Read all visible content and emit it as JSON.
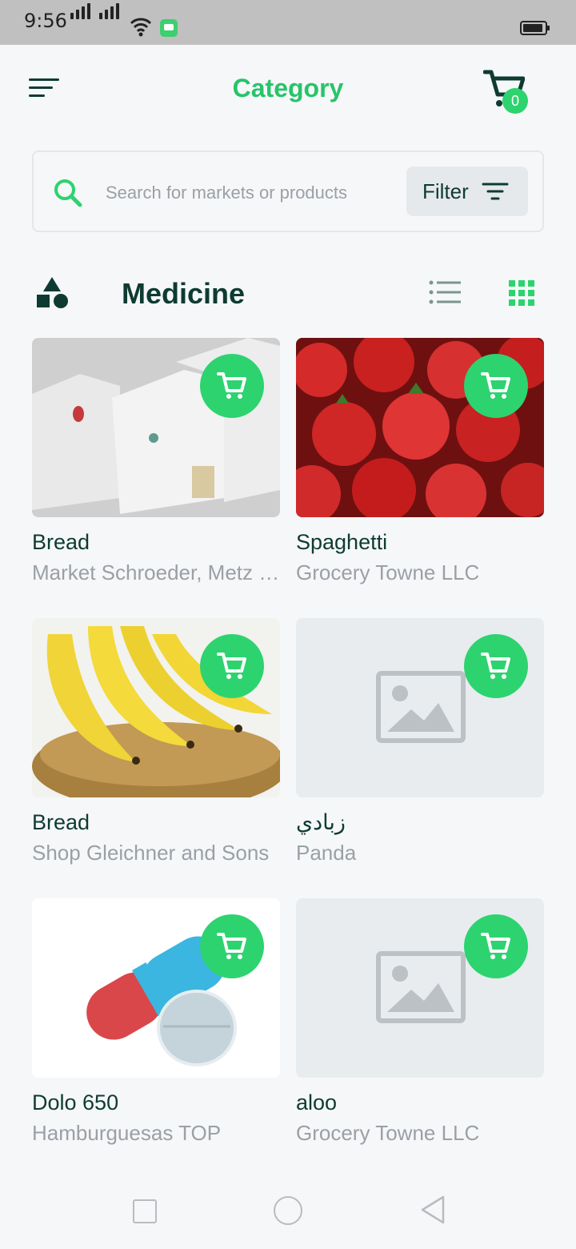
{
  "status_bar": {
    "time": "9:56"
  },
  "header": {
    "title": "Category",
    "cart_count": "0"
  },
  "search": {
    "placeholder": "Search for markets or products",
    "filter_label": "Filter"
  },
  "category": {
    "title": "Medicine"
  },
  "products": [
    {
      "name": "Bread",
      "market": "Market Schroeder, Metz and Schultz"
    },
    {
      "name": "Spaghetti",
      "market": "Grocery Towne LLC"
    },
    {
      "name": "Bread",
      "market": "Shop Gleichner and Sons"
    },
    {
      "name": "زبادي",
      "market": "Panda"
    },
    {
      "name": "Dolo 650",
      "market": "Hamburguesas TOP"
    },
    {
      "name": "aloo",
      "market": "Grocery Towne LLC"
    }
  ],
  "colors": {
    "accent": "#2dd36f",
    "title_green": "#27c46a",
    "dark": "#0d3b32",
    "muted": "#9aa0a6"
  },
  "icons": [
    "menu-icon",
    "cart-icon",
    "search-icon",
    "filter-icon",
    "shapes-icon",
    "list-view-icon",
    "grid-view-icon",
    "image-placeholder-icon"
  ]
}
